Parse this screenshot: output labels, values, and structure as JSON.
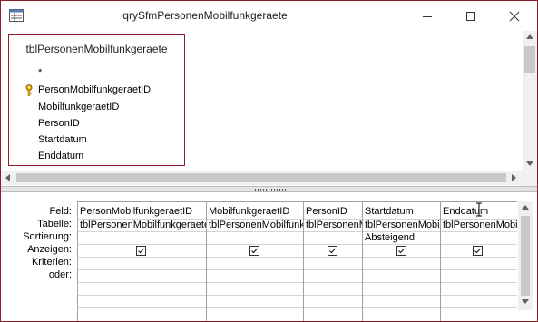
{
  "window": {
    "title": "qrySfmPersonenMobilfunkgeraete",
    "accent_color": "#8b1a2b"
  },
  "table": {
    "name": "tblPersonenMobilfunkgeraete",
    "fields": [
      {
        "name": "*",
        "primary_key": false
      },
      {
        "name": "PersonMobilfunkgeraetID",
        "primary_key": true
      },
      {
        "name": "MobilfunkgeraetID",
        "primary_key": false
      },
      {
        "name": "PersonID",
        "primary_key": false
      },
      {
        "name": "Startdatum",
        "primary_key": false
      },
      {
        "name": "Enddatum",
        "primary_key": false
      }
    ]
  },
  "grid": {
    "row_labels": {
      "feld": "Feld:",
      "tabelle": "Tabelle:",
      "sortierung": "Sortierung:",
      "anzeigen": "Anzeigen:",
      "kriterien": "Kriterien:",
      "oder": "oder:"
    },
    "columns": [
      {
        "feld": "PersonMobilfunkgeraetID",
        "tabelle": "tblPersonenMobilfunkgeraete",
        "sortierung": "",
        "anzeigen": true
      },
      {
        "feld": "MobilfunkgeraetID",
        "tabelle": "tblPersonenMobilfunkgeraete",
        "sortierung": "",
        "anzeigen": true
      },
      {
        "feld": "PersonID",
        "tabelle": "tblPersonenMobilfunkgeraete",
        "sortierung": "",
        "anzeigen": true
      },
      {
        "feld": "Startdatum",
        "tabelle": "tblPersonenMobilfunkgeraete",
        "sortierung": "Absteigend",
        "anzeigen": true
      },
      {
        "feld": "Enddatum",
        "tabelle": "tblPersonenMobilfunkgeraete",
        "sortierung": "",
        "anzeigen": true
      }
    ]
  }
}
